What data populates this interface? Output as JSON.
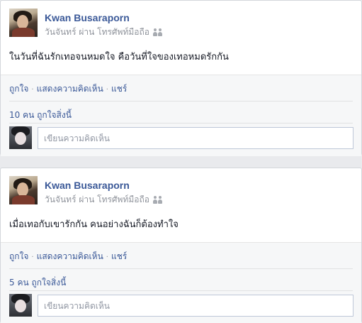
{
  "posts": [
    {
      "author": "Kwan Busaraporn",
      "meta": "วันจันทร์ ผ่าน โทรศัพท์มือถือ",
      "audience_icon": "friends-icon",
      "status": "ในวันที่ฉันรักเทอจนหมดใจ คือวันที่ใจของเทอหมดรักกัน",
      "like_label": "ถูกใจ",
      "comment_label": "แสดงความคิดเห็น",
      "share_label": "แชร์",
      "likes_text": "10 คน ถูกใจสิ่งนี้",
      "comment_placeholder": "เขียนความคิดเห็น"
    },
    {
      "author": "Kwan Busaraporn",
      "meta": "วันจันทร์ ผ่าน โทรศัพท์มือถือ",
      "audience_icon": "friends-icon",
      "status": "เมื่อเทอกับเขารักกัน คนอย่างฉันก็ต้องทำใจ",
      "like_label": "ถูกใจ",
      "comment_label": "แสดงความคิดเห็น",
      "share_label": "แชร์",
      "likes_text": "5 คน ถูกใจสิ่งนี้",
      "comment_placeholder": "เขียนความคิดเห็น"
    }
  ],
  "colors": {
    "link": "#3b5998",
    "meta": "#90949c",
    "background": "#e9eaed"
  }
}
